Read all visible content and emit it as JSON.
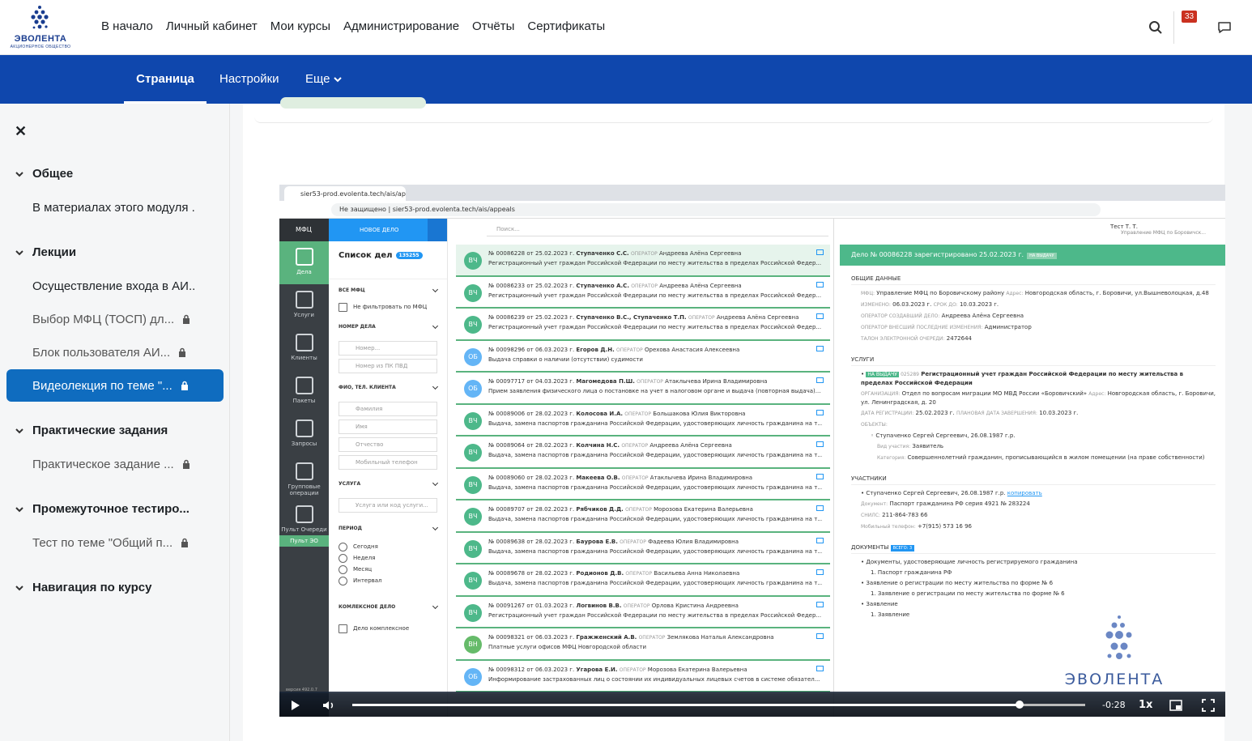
{
  "brand": {
    "name": "ЭВОЛЕНТА",
    "tagline": "АКЦИОНЕРНОЕ ОБЩЕСТВО"
  },
  "nav": [
    "В начало",
    "Личный кабинет",
    "Мои курсы",
    "Администрирование",
    "Отчёты",
    "Сертификаты"
  ],
  "notifications_count": "33",
  "secondary_nav": {
    "page": "Страница",
    "settings": "Настройки",
    "more": "Еще"
  },
  "course_index": {
    "sections": [
      {
        "title": "Общее",
        "items": [
          {
            "label": "В материалах этого модуля ...",
            "locked": false
          }
        ]
      },
      {
        "title": "Лекции",
        "items": [
          {
            "label": "Осуществление входа в АИ...",
            "locked": false
          },
          {
            "label": "Выбор МФЦ (ТОСП) дл...",
            "locked": true
          },
          {
            "label": "Блок пользователя АИ...",
            "locked": true
          },
          {
            "label": "Видеолекция по теме \"...",
            "locked": true,
            "active": true
          }
        ]
      },
      {
        "title": "Практические задания",
        "items": [
          {
            "label": "Практическое задание ...",
            "locked": true
          }
        ]
      },
      {
        "title": "Промежуточное тестиро...",
        "items": [
          {
            "label": "Тест по теме \"Общий п...",
            "locked": true
          }
        ]
      },
      {
        "title": "Навигация по курсу",
        "items": []
      }
    ]
  },
  "video": {
    "browser": {
      "tab": "sier53-prod.evolenta.tech/ais/ap",
      "security": "Не защищено",
      "url": "sier53-prod.evolenta.tech/ais/appeals"
    },
    "app": {
      "brand": "МФЦ",
      "new_case": "НОВОЕ ДЕЛО",
      "nav": [
        "Дела",
        "Услуги",
        "Клиенты",
        "Пакеты",
        "Запросы",
        "Групповые операции",
        "Пульт Очереди"
      ],
      "pult_eo": "Пульт ЭО",
      "version": "версия 492.0.7",
      "list_title": "Список дел",
      "list_count": "135255",
      "filters": {
        "all_mfc": "ВСЕ МФЦ",
        "no_filter": "Не фильтровать по МФЦ",
        "case_number": "НОМЕР ДЕЛА",
        "number_ph": "Номер...",
        "pk_ph": "Номер из ПК ПВД",
        "client": "ФИО, ТЕЛ. КЛИЕНТА",
        "surname": "Фамилия",
        "name": "Имя",
        "patronymic": "Отчество",
        "phone": "Мобильный телефон",
        "service": "УСЛУГА",
        "service_ph": "Услуга или код услуги...",
        "period": "ПЕРИОД",
        "today": "Сегодня",
        "week": "Неделя",
        "month": "Месяц",
        "interval": "Интервал",
        "complex": "КОМЛЕКСНОЕ ДЕЛО",
        "complex_ck": "Дело комплексное"
      },
      "search_ph": "Поиск...",
      "operator_label": "ОПЕРАТОР",
      "cases": [
        {
          "av": "ВЧ",
          "color": "#4db88a",
          "num": "№ 00086228",
          "date": "от 25.02.2023 г.",
          "client": "Ступаченко С.С.",
          "operator": "Андреева Алёна Сергеевна",
          "desc": "Регистрационный учет граждан Российской Федерации по месту жительства в пределах Российской Федер..."
        },
        {
          "av": "ВЧ",
          "color": "#4db88a",
          "num": "№ 00086233",
          "date": "от 25.02.2023 г.",
          "client": "Ступаченко А.С.",
          "operator": "Андреева Алёна Сергеевна",
          "desc": "Регистрационный учет граждан Российской Федерации по месту жительства в пределах Российской Федер..."
        },
        {
          "av": "ВЧ",
          "color": "#4db88a",
          "num": "№ 00086239",
          "date": "от 25.02.2023 г.",
          "client": "Ступаченко В.С., Ступаченко Т.П.",
          "operator": "Андреева Алёна Сергеевна",
          "desc": "Регистрационный учет граждан Российской Федерации по месту жительства в пределах Российской Федер..."
        },
        {
          "av": "ОБ",
          "color": "#64b5f6",
          "num": "№ 00098296",
          "date": "от 06.03.2023 г.",
          "client": "Егоров Д.Н.",
          "operator": "Орехова Анастасия Алексеевна",
          "desc": "Выдача справки о наличии (отсутствии) судимости"
        },
        {
          "av": "ОБ",
          "color": "#64b5f6",
          "num": "№ 00097717",
          "date": "от 04.03.2023 г.",
          "client": "Магомедова П.Ш.",
          "operator": "Атаклычева Ирина Владимировна",
          "desc": "Прием заявления физического лица о постановке на учет в налоговом органе и выдача (повторная выдача)..."
        },
        {
          "av": "ВЧ",
          "color": "#4db88a",
          "num": "№ 00089006",
          "date": "от 28.02.2023 г.",
          "client": "Колосова И.А.",
          "operator": "Большакова Юлия Викторовна",
          "desc": "Выдача, замена паспортов гражданина Российской Федерации, удостоверяющих личность гражданина на т..."
        },
        {
          "av": "ВЧ",
          "color": "#4db88a",
          "num": "№ 00089064",
          "date": "от 28.02.2023 г.",
          "client": "Колчина Н.С.",
          "operator": "Андреева Алёна Сергеевна",
          "desc": "Выдача, замена паспортов гражданина Российской Федерации, удостоверяющих личность гражданина на т..."
        },
        {
          "av": "ВЧ",
          "color": "#4db88a",
          "num": "№ 00089060",
          "date": "от 28.02.2023 г.",
          "client": "Макеева О.В.",
          "operator": "Атаклычева Ирина Владимировна",
          "desc": "Выдача, замена паспортов гражданина Российской Федерации, удостоверяющих личность гражданина на т..."
        },
        {
          "av": "ВЧ",
          "color": "#4db88a",
          "num": "№ 00089707",
          "date": "от 28.02.2023 г.",
          "client": "Рябчиков Д.Д.",
          "operator": "Морозова Екатерина Валерьевна",
          "desc": "Выдача, замена паспортов гражданина Российской Федерации, удостоверяющих личность гражданина на т..."
        },
        {
          "av": "ВЧ",
          "color": "#4db88a",
          "num": "№ 00089638",
          "date": "от 28.02.2023 г.",
          "client": "Баурова Е.В.",
          "operator": "Фадеева Юлия Владимировна",
          "desc": "Выдача, замена паспортов гражданина Российской Федерации, удостоверяющих личность гражданина на т..."
        },
        {
          "av": "ВЧ",
          "color": "#4db88a",
          "num": "№ 00089678",
          "date": "от 28.02.2023 г.",
          "client": "Родионов Д.В.",
          "operator": "Васильева Анна Николаевна",
          "desc": "Выдача, замена паспортов гражданина Российской Федерации, удостоверяющих личность гражданина на т..."
        },
        {
          "av": "ВЧ",
          "color": "#4db88a",
          "num": "№ 00091267",
          "date": "от 01.03.2023 г.",
          "client": "Логвинов В.В.",
          "operator": "Орлова Кристина Андреевна",
          "desc": "Регистрационный учет граждан Российской Федерации по месту жительства в пределах Российской Федер..."
        },
        {
          "av": "ВН",
          "color": "#66bb6a",
          "num": "№ 00098321",
          "date": "от 06.03.2023 г.",
          "client": "Гражженский А.В.",
          "operator": "Землякова Наталья Александровна",
          "desc": "Платные услуги офисов МФЦ Новгородской области"
        },
        {
          "av": "ОБ",
          "color": "#64b5f6",
          "num": "№ 00098312",
          "date": "от 06.03.2023 г.",
          "client": "Угарова Е.И.",
          "operator": "Морозова Екатерина Валерьевна",
          "desc": "Информирование застрахованных лиц о состоянии их индивидуальных лицевых счетов в системе обязател..."
        }
      ],
      "user": {
        "name": "Тест Т. Т.",
        "org": "Управление МФЦ по Боровичск..."
      },
      "detail": {
        "header": "Дело № 00086228 зарегистрировано 25.02.2023 г.",
        "header_tag": "НА ВЫДАЧУ",
        "general_h": "ОБЩИЕ ДАННЫЕ",
        "mfc_k": "МФЦ:",
        "mfc_v": "Управление МФЦ по Боровичскому району",
        "addr_k": "Адрес:",
        "addr_v": "Новгородская область, г. Боровичи, ул.Вышневолоцкая, д.48",
        "changed_k": "ИЗМЕНЕНО:",
        "changed_v": "06.03.2023 г.",
        "term_k": "СРОК ДО:",
        "term_v": "10.03.2023 г.",
        "creator_k": "ОПЕРАТОР СОЗДАВШИЙ ДЕЛО:",
        "creator_v": "Андреева Алёна Сергеевна",
        "lastop_k": "ОПЕРАТОР ВНЕСШИЙ ПОСЛЕДНИЕ ИЗМЕНЕНИЯ:",
        "lastop_v": "Администратор",
        "ticket_k": "ТАЛОН ЭЛЕКТРОННОЙ ОЧЕРЕДИ:",
        "ticket_v": "2472644",
        "services_h": "УСЛУГИ",
        "svc_tag": "НА ВЫДАЧУ",
        "svc_code": "025289",
        "svc_name": "Регистрационный учет граждан Российской Федерации по месту жительства в пределах Российской Федерации",
        "svc_org_k": "ОРГАНИЗАЦИЯ:",
        "svc_org_v": "Отдел по вопросам миграции МО МВД России «Боровичский»",
        "svc_addr_k": "Адрес:",
        "svc_addr_v": "Новгородская область, г. Боровичи, ул. Ленинградская, д. 20",
        "svc_reg_k": "ДАТА РЕГИСТРАЦИИ:",
        "svc_reg_v": "25.02.2023 г.",
        "svc_plan_k": "ПЛАНОВАЯ ДАТА ЗАВЕРШЕНИЯ:",
        "svc_plan_v": "10.03.2023 г.",
        "objects_k": "ОБЪЕКТЫ:",
        "obj_person": "Ступаченко Сергей Сергеевич, 26.08.1987 г.р.",
        "obj_role_k": "Вид участия:",
        "obj_role_v": "Заявитель",
        "obj_cat_k": "Категория:",
        "obj_cat_v": "Совершеннолетний гражданин, прописывающийся в жилом помещении (на праве собственности)",
        "participants_h": "УЧАСТНИКИ",
        "part_person": "Ступаченко Сергей Сергеевич, 26.08.1987 г.р.",
        "part_copy": "копировать",
        "part_doc_k": "Документ:",
        "part_doc_v": "Паспорт гражданина РФ серия 4921 № 283224",
        "part_snils_k": "СНИЛС:",
        "part_snils_v": "211-864-783 66",
        "part_phone_k": "Мобильный телефон:",
        "part_phone_v": "+7(915) 573 16 96",
        "docs_h": "ДОКУМЕНТЫ",
        "docs_count": "ВСЕГО: 3",
        "docs": [
          {
            "title": "Документы, удостоверяющие личность регистрируемого гражданина",
            "sub": "1. Паспорт гражданина РФ"
          },
          {
            "title": "Заявление о регистрации по месту жительства по форме № 6",
            "sub": "1. Заявление о регистрации по месту жительства по форме № 6"
          },
          {
            "title": "Заявление",
            "sub": "1. Заявление"
          }
        ]
      },
      "watermark": "ЭВОЛЕНТА"
    },
    "player": {
      "time_left": "-0:28",
      "speed": "1x",
      "progress": 0.91
    }
  }
}
